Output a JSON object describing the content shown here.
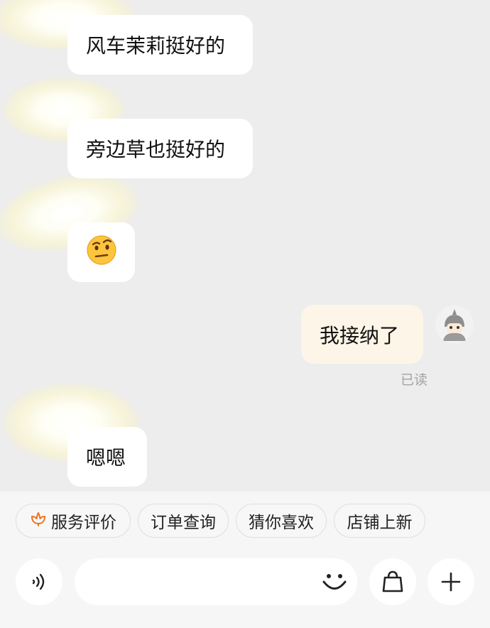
{
  "messages": [
    {
      "side": "left",
      "text": "风车茉莉挺好的"
    },
    {
      "side": "left",
      "text": "旁边草也挺好的"
    },
    {
      "side": "left",
      "text": "🤨"
    },
    {
      "side": "right",
      "text": "我接纳了",
      "status": "已读"
    },
    {
      "side": "left",
      "text": "嗯嗯"
    }
  ],
  "quick_actions": [
    {
      "label": "服务评价",
      "icon": "flower-icon"
    },
    {
      "label": "订单查询"
    },
    {
      "label": "猜你喜欢"
    },
    {
      "label": "店铺上新"
    }
  ],
  "input": {
    "value": "",
    "placeholder": ""
  },
  "icons": {
    "voice": "voice-icon",
    "emoji": "smiley-icon",
    "shop": "shopping-bag-icon",
    "more": "plus-icon"
  },
  "colors": {
    "background": "#ededed",
    "left_bubble": "#ffffff",
    "right_bubble": "#fdf5e7",
    "accent": "#e8731f"
  }
}
